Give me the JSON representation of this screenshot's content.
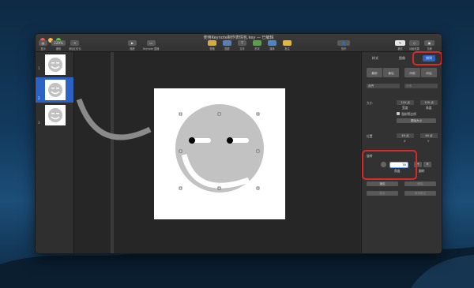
{
  "window": {
    "title": "使用Keynote制作表情包.key — 已编辑"
  },
  "toolbar": {
    "view_label": "显示",
    "zoom_value": "229%",
    "zoom_label": "缩放",
    "add_slide_label": "添加幻灯片",
    "play_label": "播放",
    "keynote_live_label": "Keynote 直播",
    "table_label": "表格",
    "chart_label": "图表",
    "text_label": "文本",
    "shape_label": "形状",
    "media_label": "媒体",
    "comment_label": "批注",
    "share_label": "协作",
    "format_label": "格式",
    "animate_label": "动画效果",
    "document_label": "文稿"
  },
  "sidebar": {
    "slides": [
      {
        "num": "1"
      },
      {
        "num": "2"
      },
      {
        "num": "3"
      }
    ]
  },
  "inspector": {
    "tabs": [
      "样式",
      "排列",
      "排列"
    ],
    "tab_style": "样式",
    "tab_text": "图像",
    "tab_arrange": "排列",
    "front_label": "最前",
    "back_label": "最后",
    "forward_label": "向前",
    "backward_label": "向后",
    "align_value": "对齐",
    "distribute_value": "分布",
    "size_label": "大小",
    "width_value": "120 点",
    "height_value": "120 点",
    "width_caption": "宽度",
    "height_caption": "高度",
    "constrain_label": "强制等比例",
    "original_size_label": "原始大小",
    "position_label": "位置",
    "x_value": "40 点",
    "y_value": "40 点",
    "x_caption": "X",
    "y_caption": "Y",
    "rotate_label": "旋转",
    "angle_value": "30",
    "angle_caption": "角度",
    "flip_caption": "翻转",
    "lock_label": "锁定",
    "unlock_label": "解锁",
    "group_label": "组合",
    "ungroup_label": "取消组合"
  },
  "colors": {
    "accent": "#2b62c4",
    "highlight": "#d72a2a",
    "face": "#c2c2c2"
  }
}
